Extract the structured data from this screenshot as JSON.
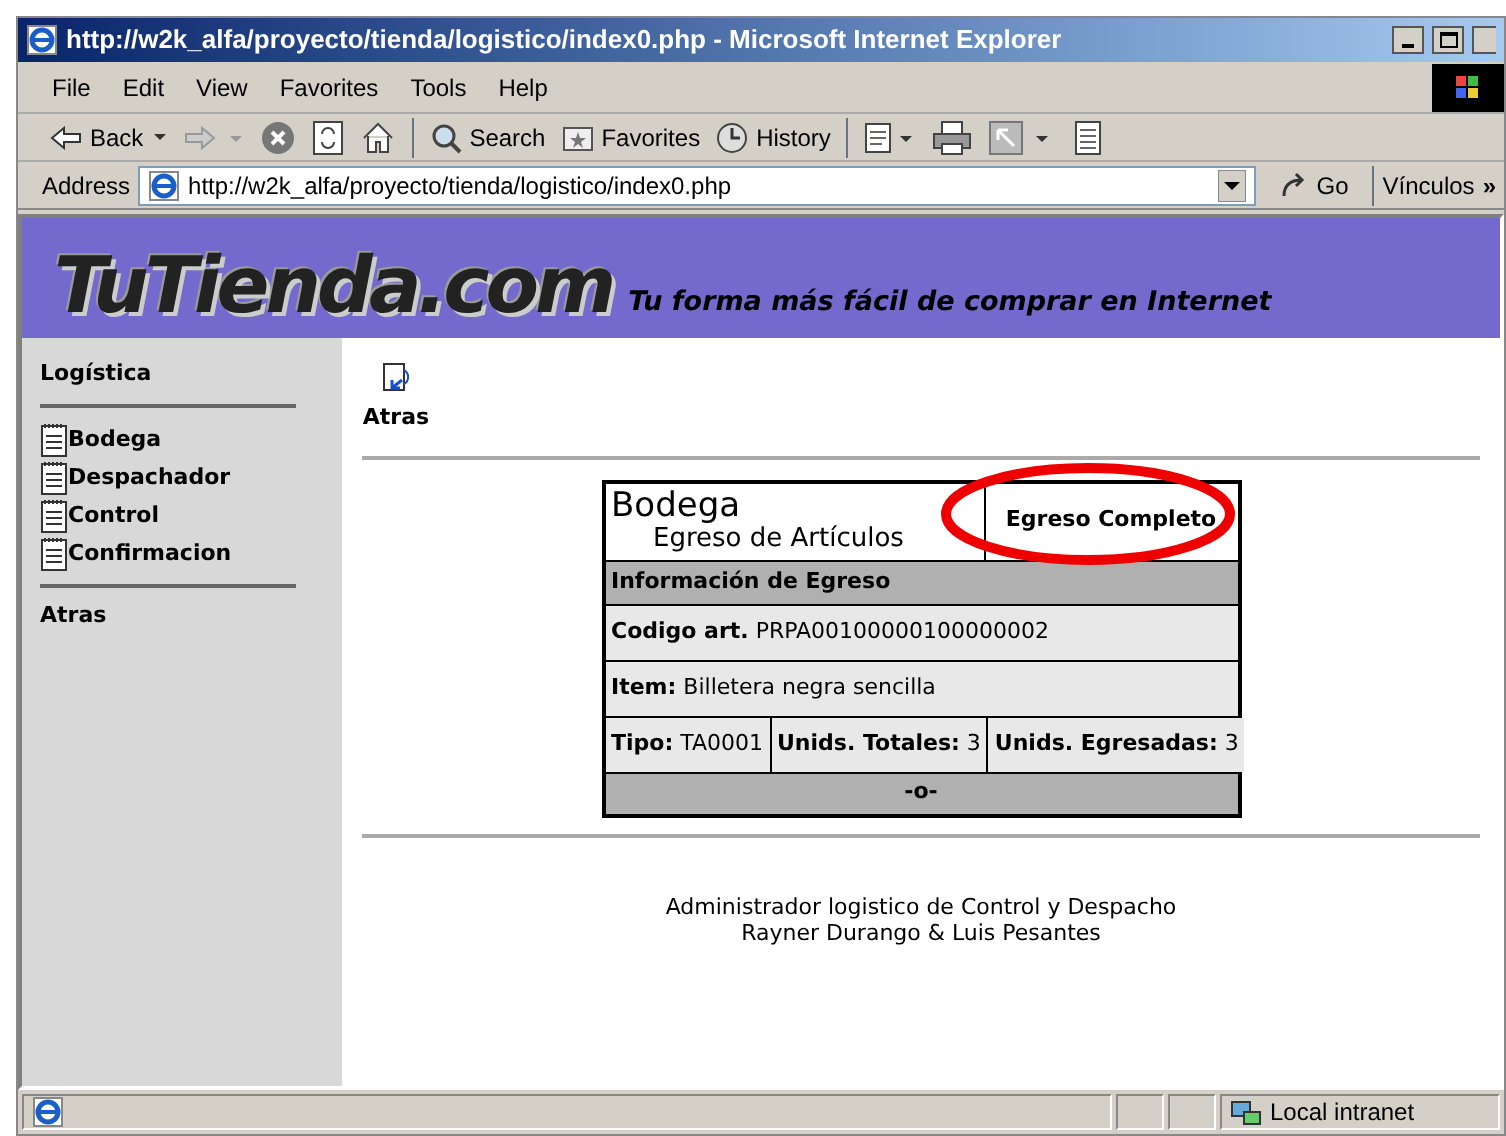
{
  "window": {
    "title": "http://w2k_alfa/proyecto/tienda/logistico/index0.php - Microsoft Internet Explorer"
  },
  "menu": [
    "File",
    "Edit",
    "View",
    "Favorites",
    "Tools",
    "Help"
  ],
  "toolbar": [
    {
      "kind": "back",
      "label": "Back"
    },
    {
      "kind": "forward"
    },
    {
      "kind": "stop"
    },
    {
      "kind": "refresh"
    },
    {
      "kind": "home"
    },
    {
      "kind": "search",
      "label": "Search"
    },
    {
      "kind": "favorites",
      "label": "Favorites"
    },
    {
      "kind": "history",
      "label": "History"
    },
    {
      "kind": "mail"
    },
    {
      "kind": "print"
    },
    {
      "kind": "edit"
    },
    {
      "kind": "discuss"
    }
  ],
  "address": {
    "label": "Address",
    "value": "http://w2k_alfa/proyecto/tienda/logistico/index0.php",
    "go": "Go",
    "links": "Vínculos",
    "more": "»"
  },
  "banner": {
    "logo": "TuTienda.com",
    "tagline": "Tu forma más fácil de comprar en Internet"
  },
  "sidebar": {
    "heading": "Logística",
    "items": [
      "Bodega",
      "Despachador",
      "Control",
      "Confirmacion"
    ],
    "back": "Atras"
  },
  "back_link": "Atras",
  "card": {
    "title": "Bodega",
    "subtitle": "Egreso de Artículos",
    "status": "Egreso Completo",
    "section": "Información de Egreso",
    "code_label": "Codigo art.",
    "code": "PRPA00100000100000002",
    "item_label": "Item:",
    "item": "Billetera negra sencilla",
    "fields": [
      {
        "label": "Tipo:",
        "value": "TA0001"
      },
      {
        "label": "Unids. Totales:",
        "value": "3"
      },
      {
        "label": "Unids. Egresadas:",
        "value": "3"
      }
    ],
    "footer": "-o-"
  },
  "footer": [
    "Administrador logistico de Control y Despacho",
    "Rayner Durango & Luis Pesantes"
  ],
  "status_bar": {
    "zone": "Local intranet"
  }
}
